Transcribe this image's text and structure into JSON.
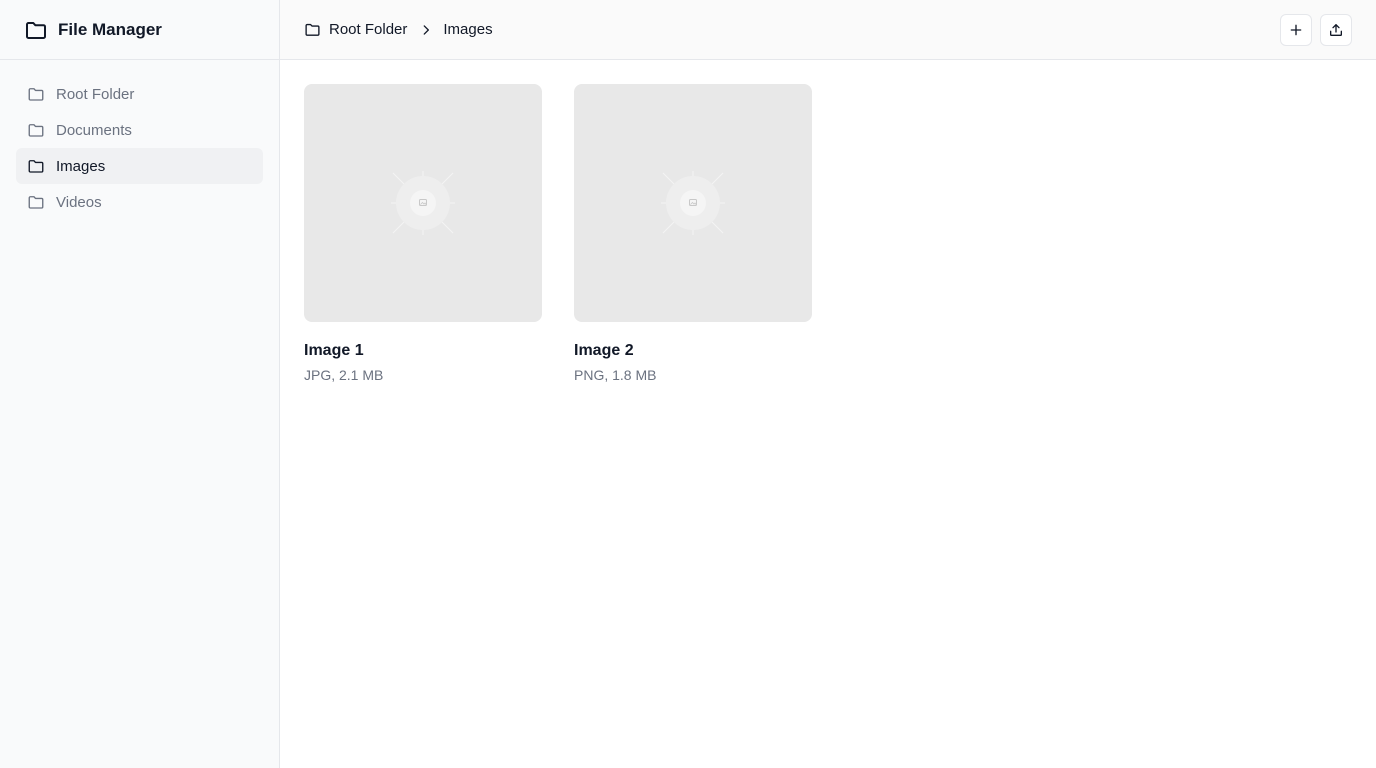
{
  "app": {
    "title": "File Manager",
    "title_icon": "folder-icon"
  },
  "sidebar": {
    "items": [
      {
        "label": "Root Folder",
        "icon": "folder-icon",
        "active": false
      },
      {
        "label": "Documents",
        "icon": "folder-icon",
        "active": false
      },
      {
        "label": "Images",
        "icon": "folder-icon",
        "active": true
      },
      {
        "label": "Videos",
        "icon": "folder-icon",
        "active": false
      }
    ]
  },
  "breadcrumb": {
    "items": [
      {
        "label": "Root Folder",
        "icon": "folder-icon"
      },
      {
        "label": "Images"
      }
    ],
    "separator_icon": "chevron-right-icon"
  },
  "toolbar": {
    "buttons": [
      {
        "icon": "plus-icon"
      },
      {
        "icon": "upload-icon"
      }
    ]
  },
  "files": [
    {
      "name": "Image 1",
      "meta": "JPG, 2.1 MB",
      "thumbnail_icon": "image-placeholder-icon"
    },
    {
      "name": "Image 2",
      "meta": "PNG, 1.8 MB",
      "thumbnail_icon": "image-placeholder-icon"
    }
  ],
  "colors": {
    "sidebar_bg": "#f9fafb",
    "active_item_bg": "#f0f1f3",
    "border": "#e5e7eb",
    "text_primary": "#111827",
    "text_muted": "#6b7280",
    "thumbnail_bg": "#e8e8e8"
  }
}
